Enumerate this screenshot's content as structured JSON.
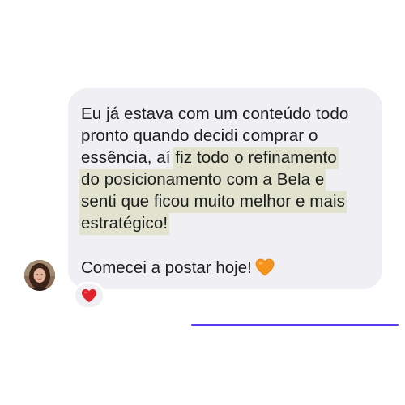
{
  "message": {
    "line1": "Eu já estava com um conteúdo todo",
    "line2": "pronto quando decidi comprar o",
    "line3_plain": "essência, aí ",
    "line3_highlight": "fiz todo o refinamento",
    "line4_highlight": "do posicionamento com a Bela e",
    "line5_highlight": "senti que ficou muito melhor e mais",
    "line6_highlight": "estratégico!",
    "second_text": "Comecei a postar hoje!",
    "second_emoji_icon": "orange-heart-icon",
    "highlight_color": "#e2e3cf",
    "bubble_color": "#efeff4"
  },
  "reaction": {
    "icon": "red-heart-icon",
    "color": "#e0242b"
  },
  "sender": {
    "avatar_icon": "avatar-photo"
  },
  "accent": {
    "divider_color": "#5b3cf0"
  }
}
